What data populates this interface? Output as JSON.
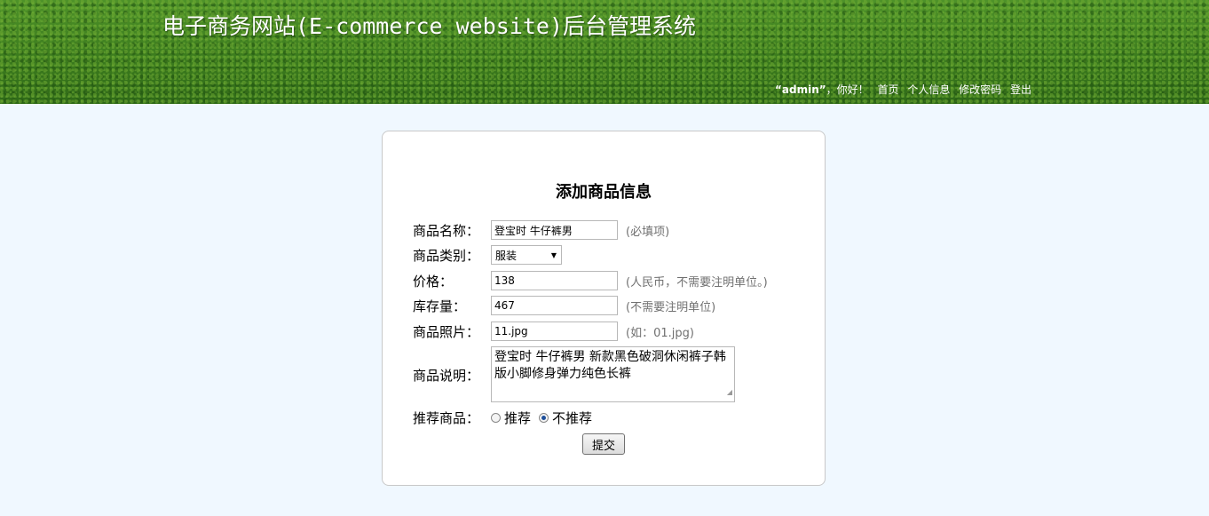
{
  "header": {
    "site_title": "电子商务网站(E-commerce website)后台管理系统",
    "username": "“admin”",
    "greeting": "，你好！",
    "nav": [
      "首页",
      "个人信息",
      "修改密码",
      "登出"
    ]
  },
  "form": {
    "title": "添加商品信息",
    "name_label": "商品名称：",
    "name_value": "登宝时 牛仔裤男",
    "name_hint": "(必填项)",
    "category_label": "商品类别：",
    "category_value": "服装",
    "price_label": "价格：",
    "price_value": "138",
    "price_hint": "(人民币，不需要注明单位。)",
    "stock_label": "库存量：",
    "stock_value": "467",
    "stock_hint": "(不需要注明单位)",
    "photo_label": "商品照片：",
    "photo_value": "11.jpg",
    "photo_hint": "(如：01.jpg)",
    "desc_label": "商品说明：",
    "desc_value": "登宝时 牛仔裤男 新款黑色破洞休闲裤子韩版小脚修身弹力纯色长裤",
    "recommend_label": "推荐商品：",
    "recommend_options": [
      "推荐",
      "不推荐"
    ],
    "recommend_selected": "不推荐",
    "submit_label": "提交"
  },
  "colors": {
    "page_bg": "#f0f8ff",
    "header_green": "#3f7f22",
    "radio_accent": "#1e4f9a"
  }
}
